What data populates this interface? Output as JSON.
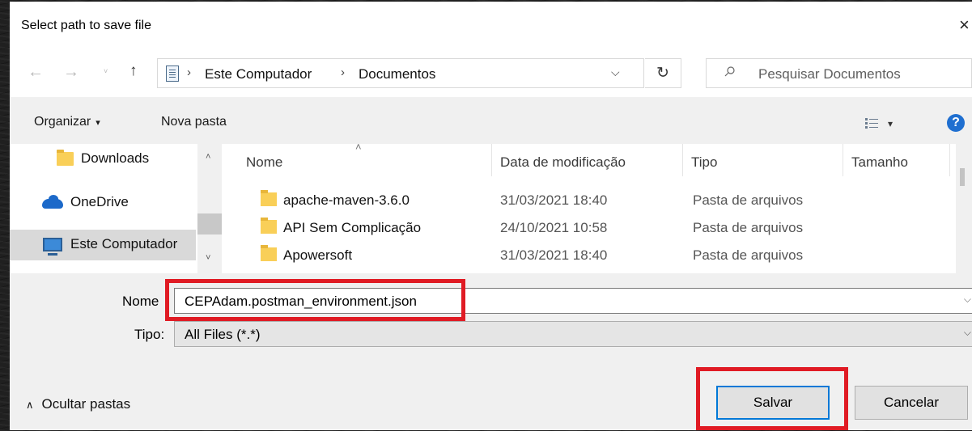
{
  "dialog": {
    "title": "Select path to save file",
    "close_icon": "×"
  },
  "navigation": {
    "back_icon": "←",
    "forward_icon": "→",
    "recent_icon": "˅",
    "up_icon": "↑",
    "path": [
      "Este Computador",
      "Documentos"
    ],
    "path_separator": "›",
    "dropdown_icon": "⌵",
    "refresh_icon": "↻",
    "search_placeholder": "Pesquisar Documentos"
  },
  "toolbar": {
    "organize_label": "Organizar",
    "organize_caret": "▾",
    "new_folder_label": "Nova pasta",
    "view_caret": "▾",
    "help_label": "?"
  },
  "sidebar": {
    "items": [
      {
        "label": "Downloads",
        "icon": "folder-icon"
      },
      {
        "label": "OneDrive",
        "icon": "onedrive-icon"
      },
      {
        "label": "Este Computador",
        "icon": "computer-icon",
        "selected": true
      }
    ],
    "scroll_up": "˄",
    "scroll_down": "˅"
  },
  "file_list": {
    "sort_caret": "˄",
    "columns": [
      "Nome",
      "Data de modificação",
      "Tipo",
      "Tamanho"
    ],
    "rows": [
      {
        "name": "apache-maven-3.6.0",
        "date": "31/03/2021 18:40",
        "type": "Pasta de arquivos",
        "size": ""
      },
      {
        "name": "API Sem Complicação",
        "date": "24/10/2021 10:58",
        "type": "Pasta de arquivos",
        "size": ""
      },
      {
        "name": "Apowersoft",
        "date": "31/03/2021 18:40",
        "type": "Pasta de arquivos",
        "size": ""
      }
    ]
  },
  "form": {
    "name_label": "Nome",
    "name_value": "CEPAdam.postman_environment.json",
    "type_label": "Tipo:",
    "type_value": "All Files (*.*)",
    "dropdown_icon": "⌵"
  },
  "footer": {
    "hide_folders_icon": "∧",
    "hide_folders_label": "Ocultar pastas",
    "save_label": "Salvar",
    "cancel_label": "Cancelar"
  },
  "colors": {
    "highlight": "#e01b24",
    "primary_border": "#0078d7",
    "folder": "#f9cf58"
  }
}
